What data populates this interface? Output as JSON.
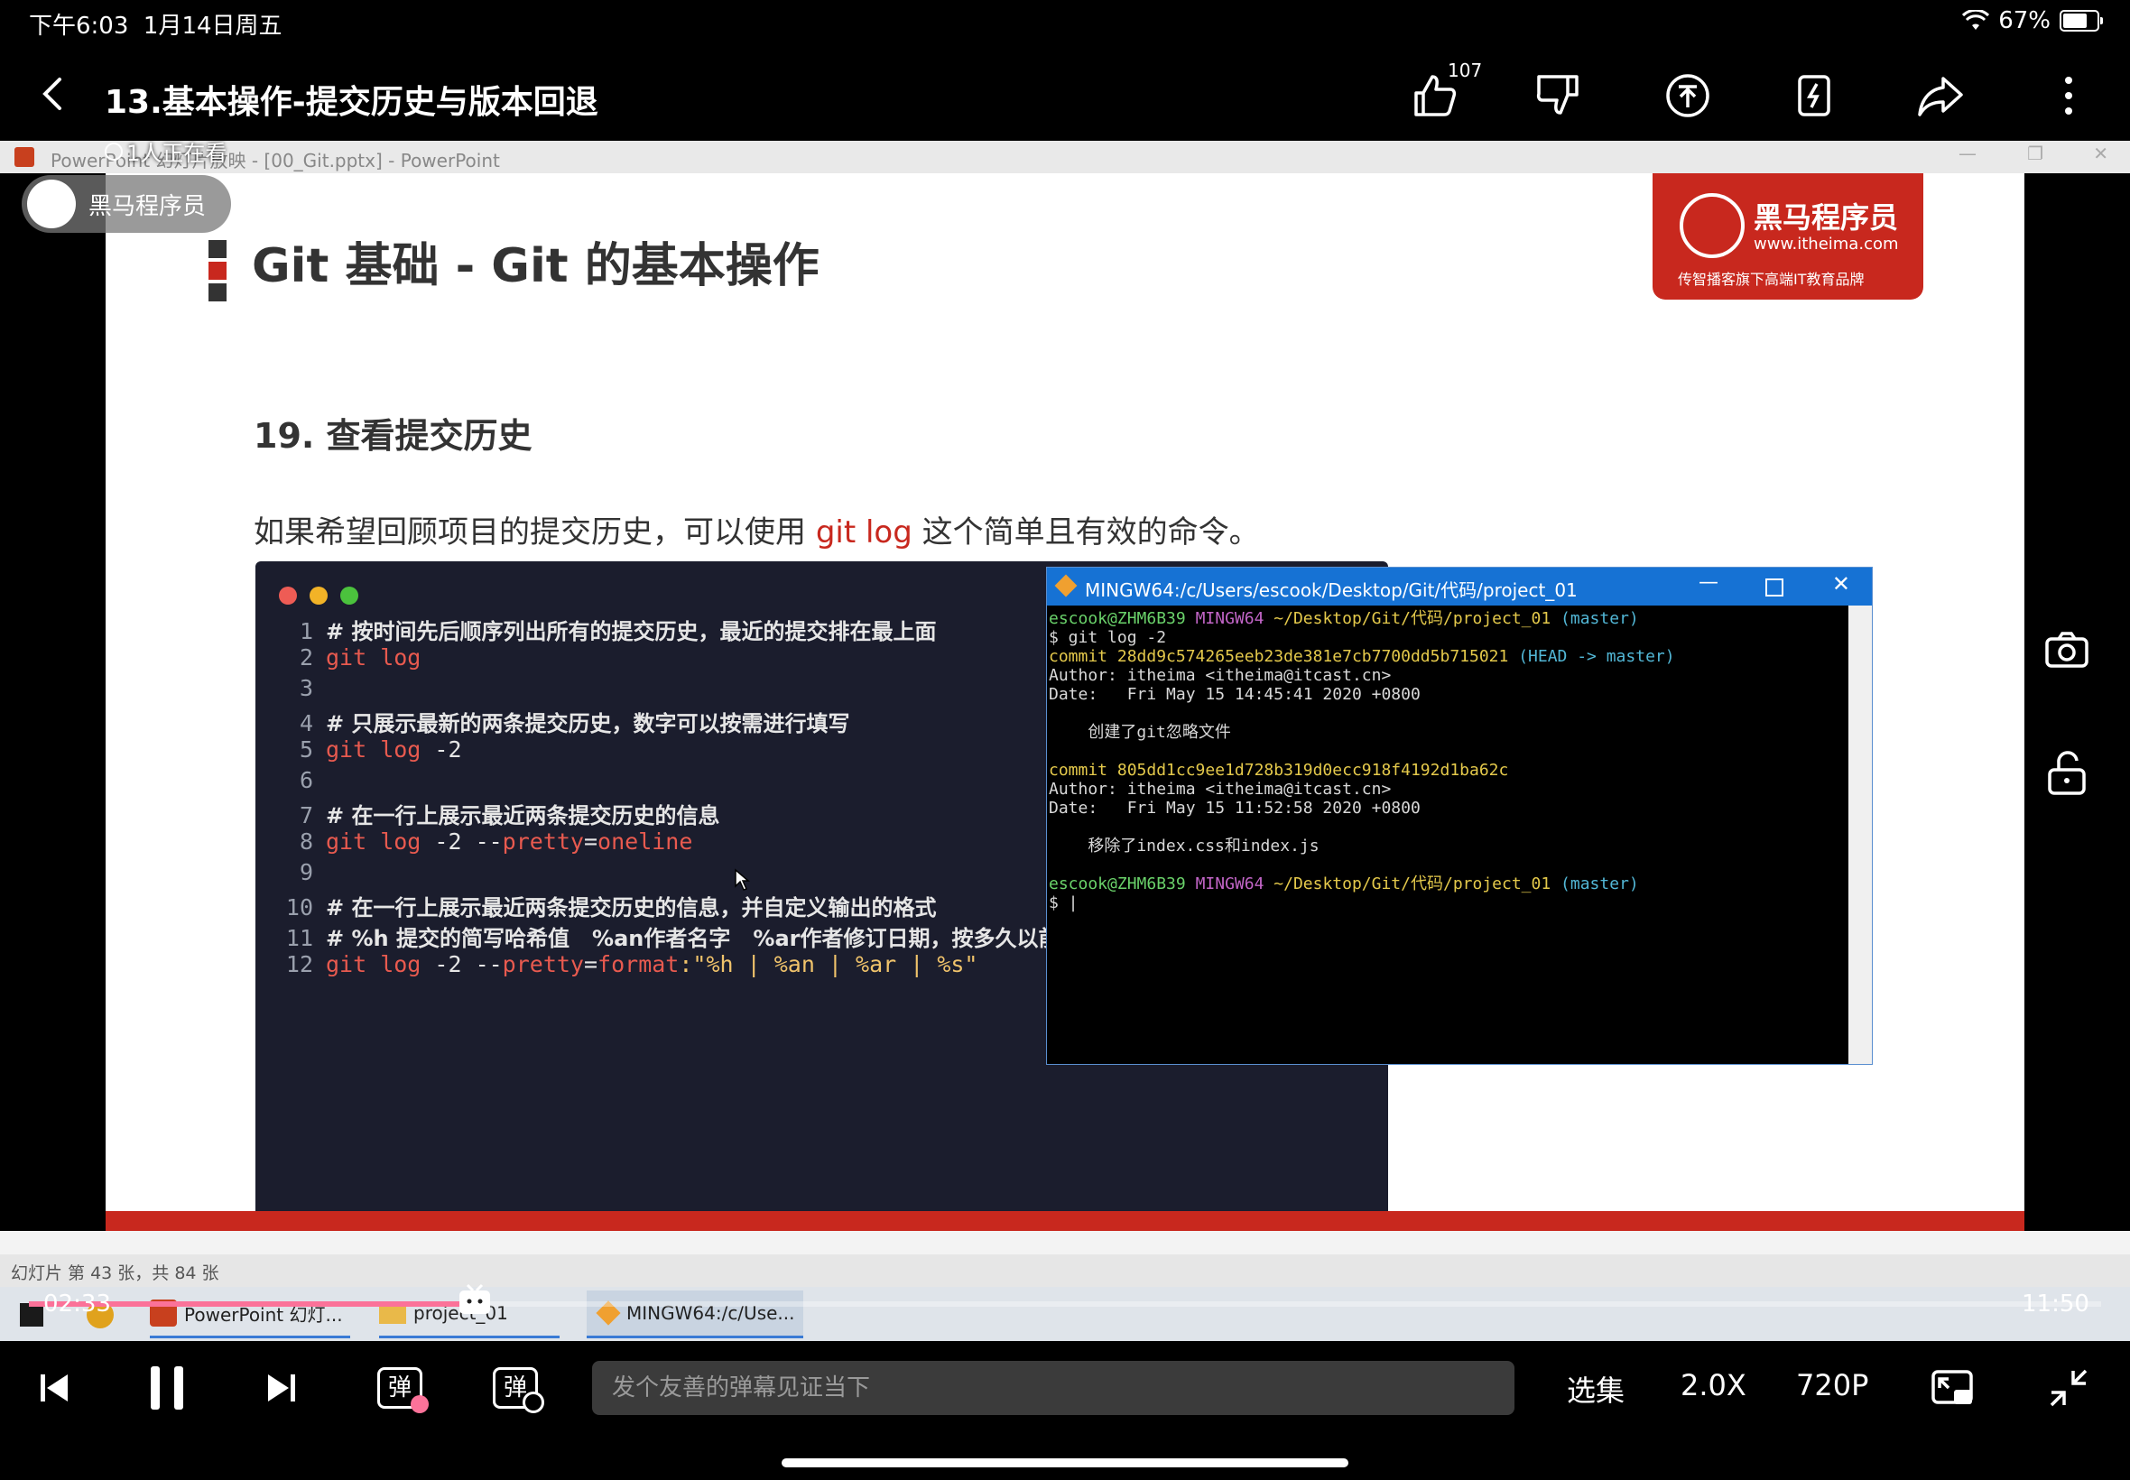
{
  "status_bar": {
    "time": "下午6:03",
    "date": "1月14日周五",
    "battery": "67%"
  },
  "header": {
    "title": "13.基本操作-提交历史与版本回退",
    "like_count": "107",
    "icons": [
      "back-icon",
      "thumb-up-icon",
      "thumb-down-icon",
      "coin-icon",
      "collect-icon",
      "share-icon",
      "more-icon"
    ]
  },
  "overlay": {
    "watchers": "1人正在看",
    "uploader_name": "黑马程序员",
    "uploader_avatar_text": "黑马程序员"
  },
  "ppt": {
    "window_title": "PowerPoint 幻灯片放映 - [00_Git.pptx] - PowerPoint",
    "slide_status": "幻灯片 第 43 张，共 84 张",
    "slide_title": "Git 基础 - Git 的基本操作",
    "logo_name": "黑马程序员",
    "logo_url": "www.itheima.com",
    "logo_slogan": "传智播客旗下高端IT教育品牌",
    "section": "19. 查看提交历史",
    "desc_before": "如果希望回顾项目的提交历史，可以使用 ",
    "desc_cmd": "git log",
    "desc_after": " 这个简单且有效的命令。",
    "code_lines": [
      {
        "n": "1",
        "comment": "# 按时间先后顺序列出所有的提交历史，最近的提交排在最上面"
      },
      {
        "n": "2",
        "cmd": "git log",
        "args": ""
      },
      {
        "n": "3"
      },
      {
        "n": "4",
        "comment": "# 只展示最新的两条提交历史，数字可以按需进行填写"
      },
      {
        "n": "5",
        "cmd": "git log",
        "args": " -2"
      },
      {
        "n": "6"
      },
      {
        "n": "7",
        "comment": "# 在一行上展示最近两条提交历史的信息"
      },
      {
        "n": "8",
        "cmd": "git log",
        "args": " -2 --",
        "kw2": "pretty",
        "eq": "=",
        "val": "oneline"
      },
      {
        "n": "9"
      },
      {
        "n": "10",
        "comment": "# 在一行上展示最近两条提交历史的信息，并自定义输出的格式"
      },
      {
        "n": "11",
        "comment": "# %h 提交的简写哈希值   %an作者名字   %ar作者修订日期，按多久以前的方式显示   %s提交说明"
      },
      {
        "n": "12",
        "cmd": "git log",
        "args": " -2 --",
        "kw2": "pretty",
        "eq": "=",
        "val": "format",
        "str": ":\"%h | %an | %ar | %s\""
      }
    ]
  },
  "terminal": {
    "title": "MINGW64:/c/Users/escook/Desktop/Git/代码/project_01",
    "prompt_user": "escook@ZHM6B39",
    "prompt_env": "MINGW64",
    "prompt_path": "~/Desktop/Git/代码/project_01",
    "prompt_branch": "(master)",
    "command": "$ git log -2",
    "commit1": "commit 28dd9c574265eeb23de381e7cb7700dd5b715021",
    "commit1_ref": "(HEAD -> master)",
    "author1": "Author: itheima <itheima@itcast.cn>",
    "date1": "Date:   Fri May 15 14:45:41 2020 +0800",
    "msg1": "    创建了git忽略文件",
    "commit2": "commit 805dd1cc9ee1d728b319d0ecc918f4192d1ba62c",
    "author2": "Author: itheima <itheima@itcast.cn>",
    "date2": "Date:   Fri May 15 11:52:58 2020 +0800",
    "msg2": "    移除了index.css和index.js",
    "cursor": "$ |"
  },
  "taskbar": {
    "items": [
      "PowerPoint 幻灯...",
      "project_01",
      "MINGW64:/c/Use..."
    ]
  },
  "player": {
    "current_time": "02:33",
    "duration": "11:50",
    "progress": 0.215,
    "danmaku_placeholder": "发个友善的弹幕见证当下",
    "episodes": "选集",
    "speed": "2.0X",
    "quality": "720P",
    "danmaku_label": "弹"
  },
  "colors": {
    "accent": "#fb7299",
    "brand_red": "#c8281e",
    "terminal_title": "#1672d4"
  }
}
